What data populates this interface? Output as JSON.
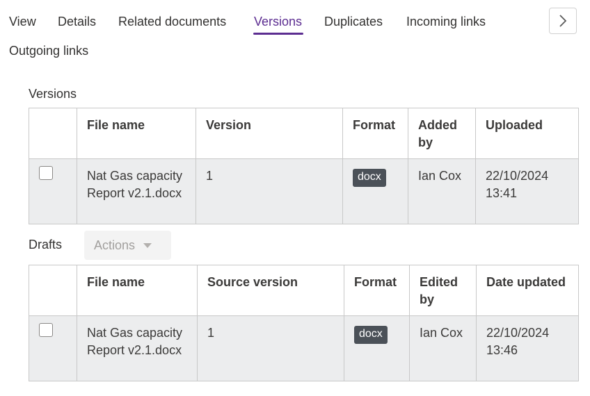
{
  "tabs": [
    {
      "label": "View"
    },
    {
      "label": "Details"
    },
    {
      "label": "Related documents"
    },
    {
      "label": "Versions",
      "active": true
    },
    {
      "label": "Duplicates"
    },
    {
      "label": "Incoming links"
    },
    {
      "label": "Outgoing links"
    }
  ],
  "scroll_icon": "chevron-right-icon",
  "accent_color": "#5c2d91",
  "versions": {
    "title": "Versions",
    "headers": [
      "",
      "File name",
      "Version",
      "Format",
      "Added by",
      "Uploaded"
    ],
    "rows": [
      {
        "file_name": "Nat Gas capacity Report v2.1.docx",
        "version": "1",
        "format": "docx",
        "added_by": "Ian Cox",
        "uploaded": "22/10/2024 13:41"
      }
    ]
  },
  "drafts": {
    "title": "Drafts",
    "actions_label": "Actions",
    "headers": [
      "",
      "File name",
      "Source version",
      "Format",
      "Edited by",
      "Date updated"
    ],
    "rows": [
      {
        "file_name": "Nat Gas capacity Report v2.1.docx",
        "source_version": "1",
        "format": "docx",
        "edited_by": "Ian Cox",
        "date_updated": "22/10/2024 13:46"
      }
    ]
  }
}
